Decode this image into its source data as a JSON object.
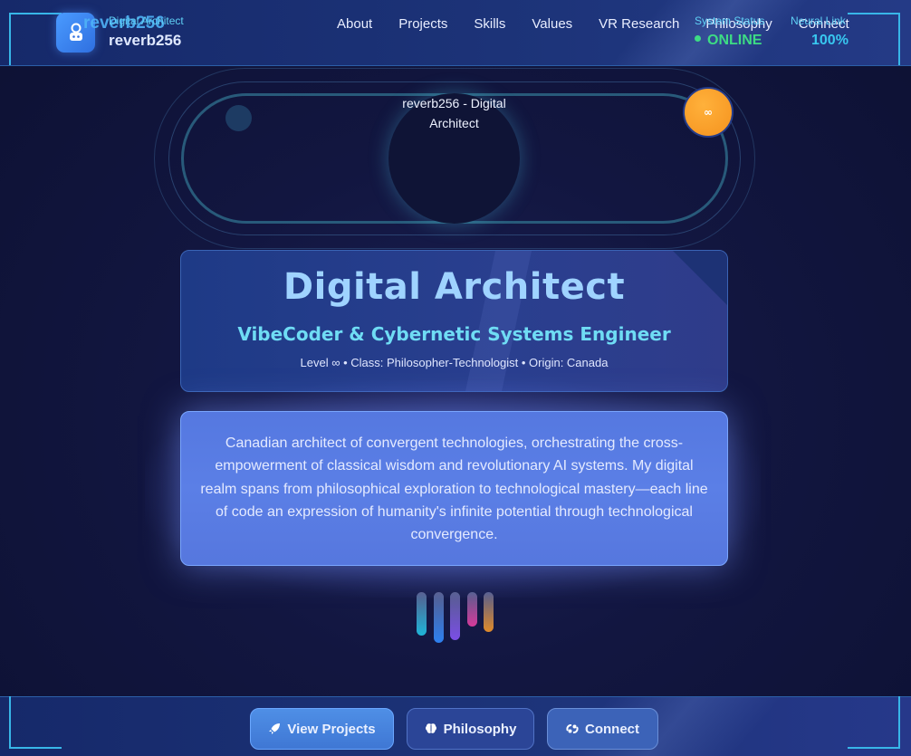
{
  "header": {
    "logo_ghost": "reverb256",
    "logo_subtitle": "Digital Architect",
    "logo_name": "reverb256",
    "nav": [
      {
        "label": "About"
      },
      {
        "label": "Projects"
      },
      {
        "label": "Skills"
      },
      {
        "label": "Values"
      },
      {
        "label": "VR Research"
      },
      {
        "label": "Philosophy"
      },
      {
        "label": "Connect"
      }
    ],
    "system_status_label": "System Status",
    "system_status_value": "ONLINE",
    "neural_link_label": "Neural Link",
    "neural_link_value": "100%"
  },
  "hero": {
    "avatar_alt": "reverb256 - Digital Architect",
    "level_badge": "∞"
  },
  "title_card": {
    "title": "Digital Architect",
    "subtitle": "VibeCoder & Cybernetic Systems Engineer",
    "meta": "Level ∞ • Class: Philosopher-Technologist • Origin: Canada"
  },
  "bio": {
    "text": "Canadian architect of convergent technologies, orchestrating the cross-empowerment of classical wisdom and revolutionary AI systems. My digital realm spans from philosophical exploration to technological mastery—each line of code an expression of humanity's infinite potential through technological convergence."
  },
  "equalizer": {
    "levels": [
      0.72,
      0.85,
      0.8,
      0.58,
      0.66
    ],
    "colors": [
      "#1fb5d8",
      "#2d80f0",
      "#7b4ee6",
      "#d63a9a",
      "#e08a2a"
    ]
  },
  "footer": {
    "buttons": [
      {
        "label": "View Projects",
        "icon": "rocket-icon"
      },
      {
        "label": "Philosophy",
        "icon": "brain-icon"
      },
      {
        "label": "Connect",
        "icon": "link-icon"
      }
    ]
  },
  "colors": {
    "accent": "#38c8f0",
    "online": "#3ddc84",
    "badge": "#f5921e",
    "title": "#9fd3ff"
  }
}
